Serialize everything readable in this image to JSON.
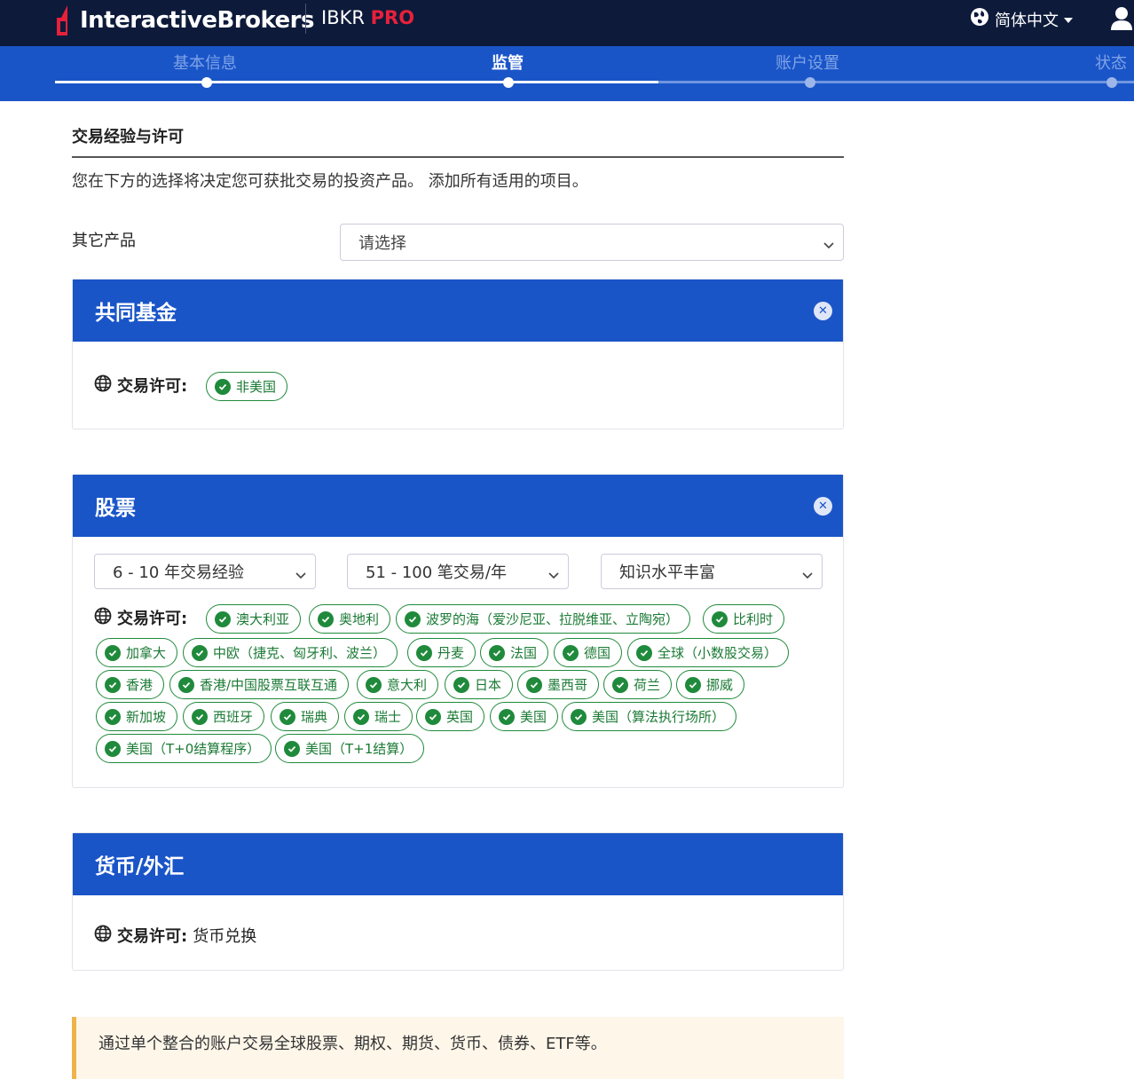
{
  "header": {
    "brand": "InteractiveBrokers",
    "product_prefix": "IBKR",
    "product_suffix": "PRO",
    "language": "简体中文"
  },
  "steps": [
    {
      "label": "基本信息",
      "state": "done"
    },
    {
      "label": "监管",
      "state": "active"
    },
    {
      "label": "账户设置",
      "state": "pending"
    },
    {
      "label": "状态",
      "state": "pending"
    }
  ],
  "section": {
    "title": "交易经验与许可",
    "description": "您在下方的选择将决定您可获批交易的投资产品。 添加所有适用的项目。",
    "other_products_label": "其它产品",
    "other_products_value": "请选择"
  },
  "perm_label": "交易许可:",
  "cards": {
    "mutual_funds": {
      "title": "共同基金",
      "permissions": [
        "非美国"
      ]
    },
    "stocks": {
      "title": "股票",
      "experience": "6 - 10 年交易经验",
      "trades": "51 - 100 笔交易/年",
      "knowledge": "知识水平丰富",
      "permissions": [
        "澳大利亚",
        "奥地利",
        "波罗的海（爱沙尼亚、拉脱维亚、立陶宛）",
        "比利时",
        "加拿大",
        "中欧（捷克、匈牙利、波兰）",
        "丹麦",
        "法国",
        "德国",
        "全球（小数股交易）",
        "香港",
        "香港/中国股票互联互通",
        "意大利",
        "日本",
        "墨西哥",
        "荷兰",
        "挪威",
        "新加坡",
        "西班牙",
        "瑞典",
        "瑞士",
        "英国",
        "美国",
        "美国（算法执行场所）",
        "美国（T+0结算程序）",
        "美国（T+1结算）"
      ]
    },
    "forex": {
      "title": "货币/外汇",
      "permission_text": "货币兑换"
    }
  },
  "notice": {
    "line1": "通过单个整合的账户交易全球股票、期权、期货、货币、债券、ETF等。"
  },
  "colors": {
    "topbar": "#0d1a3a",
    "primary": "#1a55c8",
    "chip_green": "#1f8a3b",
    "notice_bg": "#fdf6e9",
    "notice_border": "#f0b24a"
  }
}
